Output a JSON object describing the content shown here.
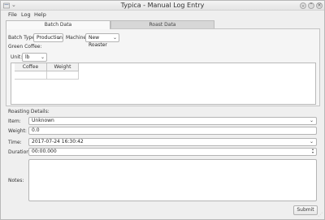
{
  "window": {
    "title": "Typica - Manual Log Entry"
  },
  "menu": {
    "file": "File",
    "log": "Log",
    "help": "Help"
  },
  "tabs": {
    "batch": "Batch Data",
    "roast": "Roast Data"
  },
  "batch": {
    "batch_type_label": "Batch Type:",
    "batch_type_value": "Production",
    "machine_label": "Machine:",
    "machine_value": "New Roaster",
    "green_coffee_label": "Green Coffee:",
    "unit_label": "Unit:",
    "unit_value": "lb",
    "table_headers": [
      "Coffee",
      "Weight"
    ]
  },
  "roasting": {
    "section_label": "Roasting Details:",
    "item_label": "Item:",
    "item_value": "Unknown",
    "weight_label": "Weight:",
    "weight_value": "0.0",
    "time_label": "Time:",
    "time_value": "2017-07-24 16:30:42",
    "duration_label": "Duration:",
    "duration_value": "00:00.000",
    "notes_label": "Notes:"
  },
  "actions": {
    "submit": "Submit"
  }
}
